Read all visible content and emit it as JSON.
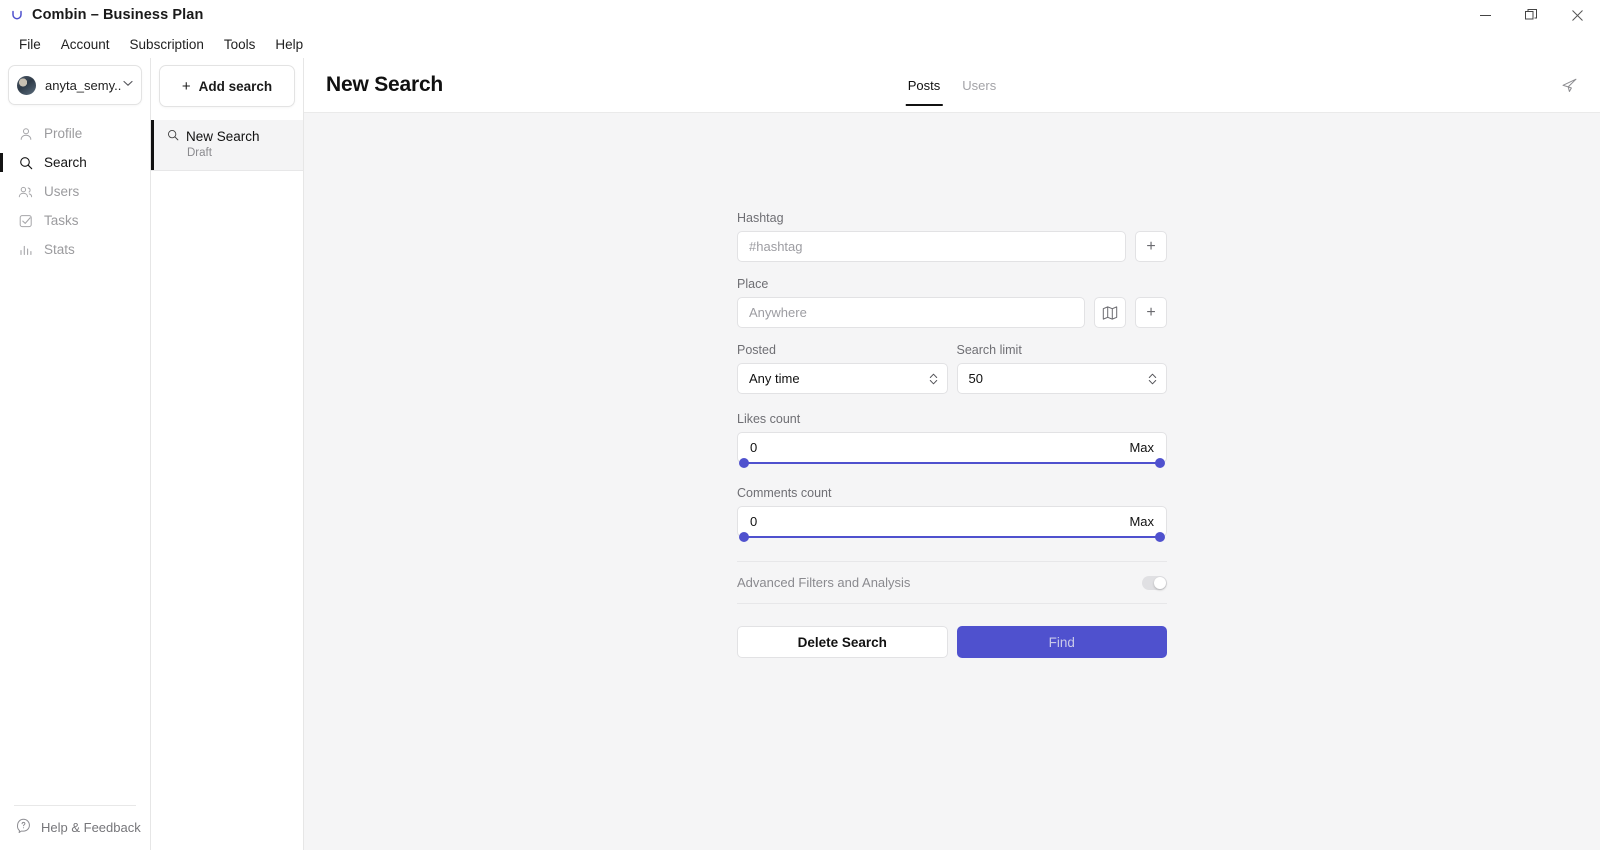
{
  "window": {
    "title": "Combin – Business Plan",
    "logo_icon": "combin-logo-icon",
    "controls": {
      "minimize": "minimize-icon",
      "restore": "restore-icon",
      "close": "close-icon"
    }
  },
  "menubar": {
    "items": [
      {
        "label": "File"
      },
      {
        "label": "Account"
      },
      {
        "label": "Subscription"
      },
      {
        "label": "Tools"
      },
      {
        "label": "Help"
      }
    ]
  },
  "sidebar": {
    "account": {
      "username": "anyta_semy...",
      "avatar_icon": "user-avatar",
      "chevron_icon": "chevron-down-icon"
    },
    "items": [
      {
        "label": "Profile",
        "icon": "person-icon",
        "active": false
      },
      {
        "label": "Search",
        "icon": "search-icon",
        "active": true
      },
      {
        "label": "Users",
        "icon": "users-icon",
        "active": false
      },
      {
        "label": "Tasks",
        "icon": "checklist-icon",
        "active": false
      },
      {
        "label": "Stats",
        "icon": "bar-chart-icon",
        "active": false
      }
    ],
    "help": {
      "label": "Help & Feedback",
      "icon": "question-bubble-icon"
    }
  },
  "searchlist": {
    "add_button": {
      "label": "Add search",
      "icon": "plus-icon"
    },
    "items": [
      {
        "title": "New Search",
        "status": "Draft",
        "icon": "search-icon",
        "selected": true
      }
    ]
  },
  "main": {
    "title": "New Search",
    "send_icon": "send-icon",
    "tabs": [
      {
        "label": "Posts",
        "active": true
      },
      {
        "label": "Users",
        "active": false
      }
    ],
    "form": {
      "hashtag": {
        "label": "Hashtag",
        "value": "",
        "placeholder": "#hashtag",
        "add_button_icon": "plus-icon",
        "add_button_label": "+"
      },
      "place": {
        "label": "Place",
        "value": "",
        "placeholder": "Anywhere",
        "map_button_icon": "map-icon",
        "add_button_label": "+"
      },
      "posted": {
        "label": "Posted",
        "value": "Any time",
        "stepper_icon": "stepper-updown-icon"
      },
      "search_limit": {
        "label": "Search limit",
        "value": "50",
        "stepper_icon": "stepper-updown-icon"
      },
      "likes_count": {
        "label": "Likes count",
        "min_value": "0",
        "max_value": "Max"
      },
      "comments_count": {
        "label": "Comments count",
        "min_value": "0",
        "max_value": "Max"
      },
      "advanced": {
        "label": "Advanced Filters and Analysis",
        "enabled": false
      },
      "delete_button": "Delete Search",
      "find_button": "Find"
    }
  },
  "colors": {
    "accent": "#4f51ce",
    "content_bg": "#f5f5f6",
    "panel_bg": "#ffffff",
    "border": "#e6e6e6",
    "text": "#111111",
    "muted_text": "#8a8a8f"
  }
}
